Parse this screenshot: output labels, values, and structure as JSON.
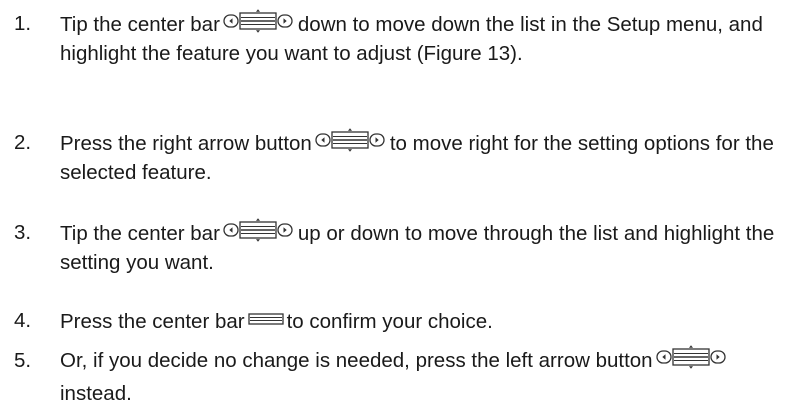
{
  "steps": [
    {
      "number": "1.",
      "text_a": "Tip the center bar",
      "control_icon": "navigation-control-icon",
      "text_b": "down to move down the list in the Setup menu, and highlight the feature you want to adjust (Figure 13)."
    },
    {
      "number": "2.",
      "text_a": "Press the right arrow button",
      "control_icon": "navigation-control-icon",
      "text_b": "to move right for the setting options for the selected feature."
    },
    {
      "number": "3.",
      "text_a": "Tip the center bar",
      "control_icon": "navigation-control-icon",
      "text_b": "up or down to move through the list and highlight the setting you want."
    },
    {
      "number": "4.",
      "text_a": "Press the center bar",
      "control_icon": "center-bar-icon",
      "text_b": "to confirm your choice."
    },
    {
      "number": "5.",
      "text_a": "Or, if you decide no change is needed, press the left arrow button",
      "control_icon": "navigation-control-icon",
      "text_b": "instead."
    }
  ]
}
